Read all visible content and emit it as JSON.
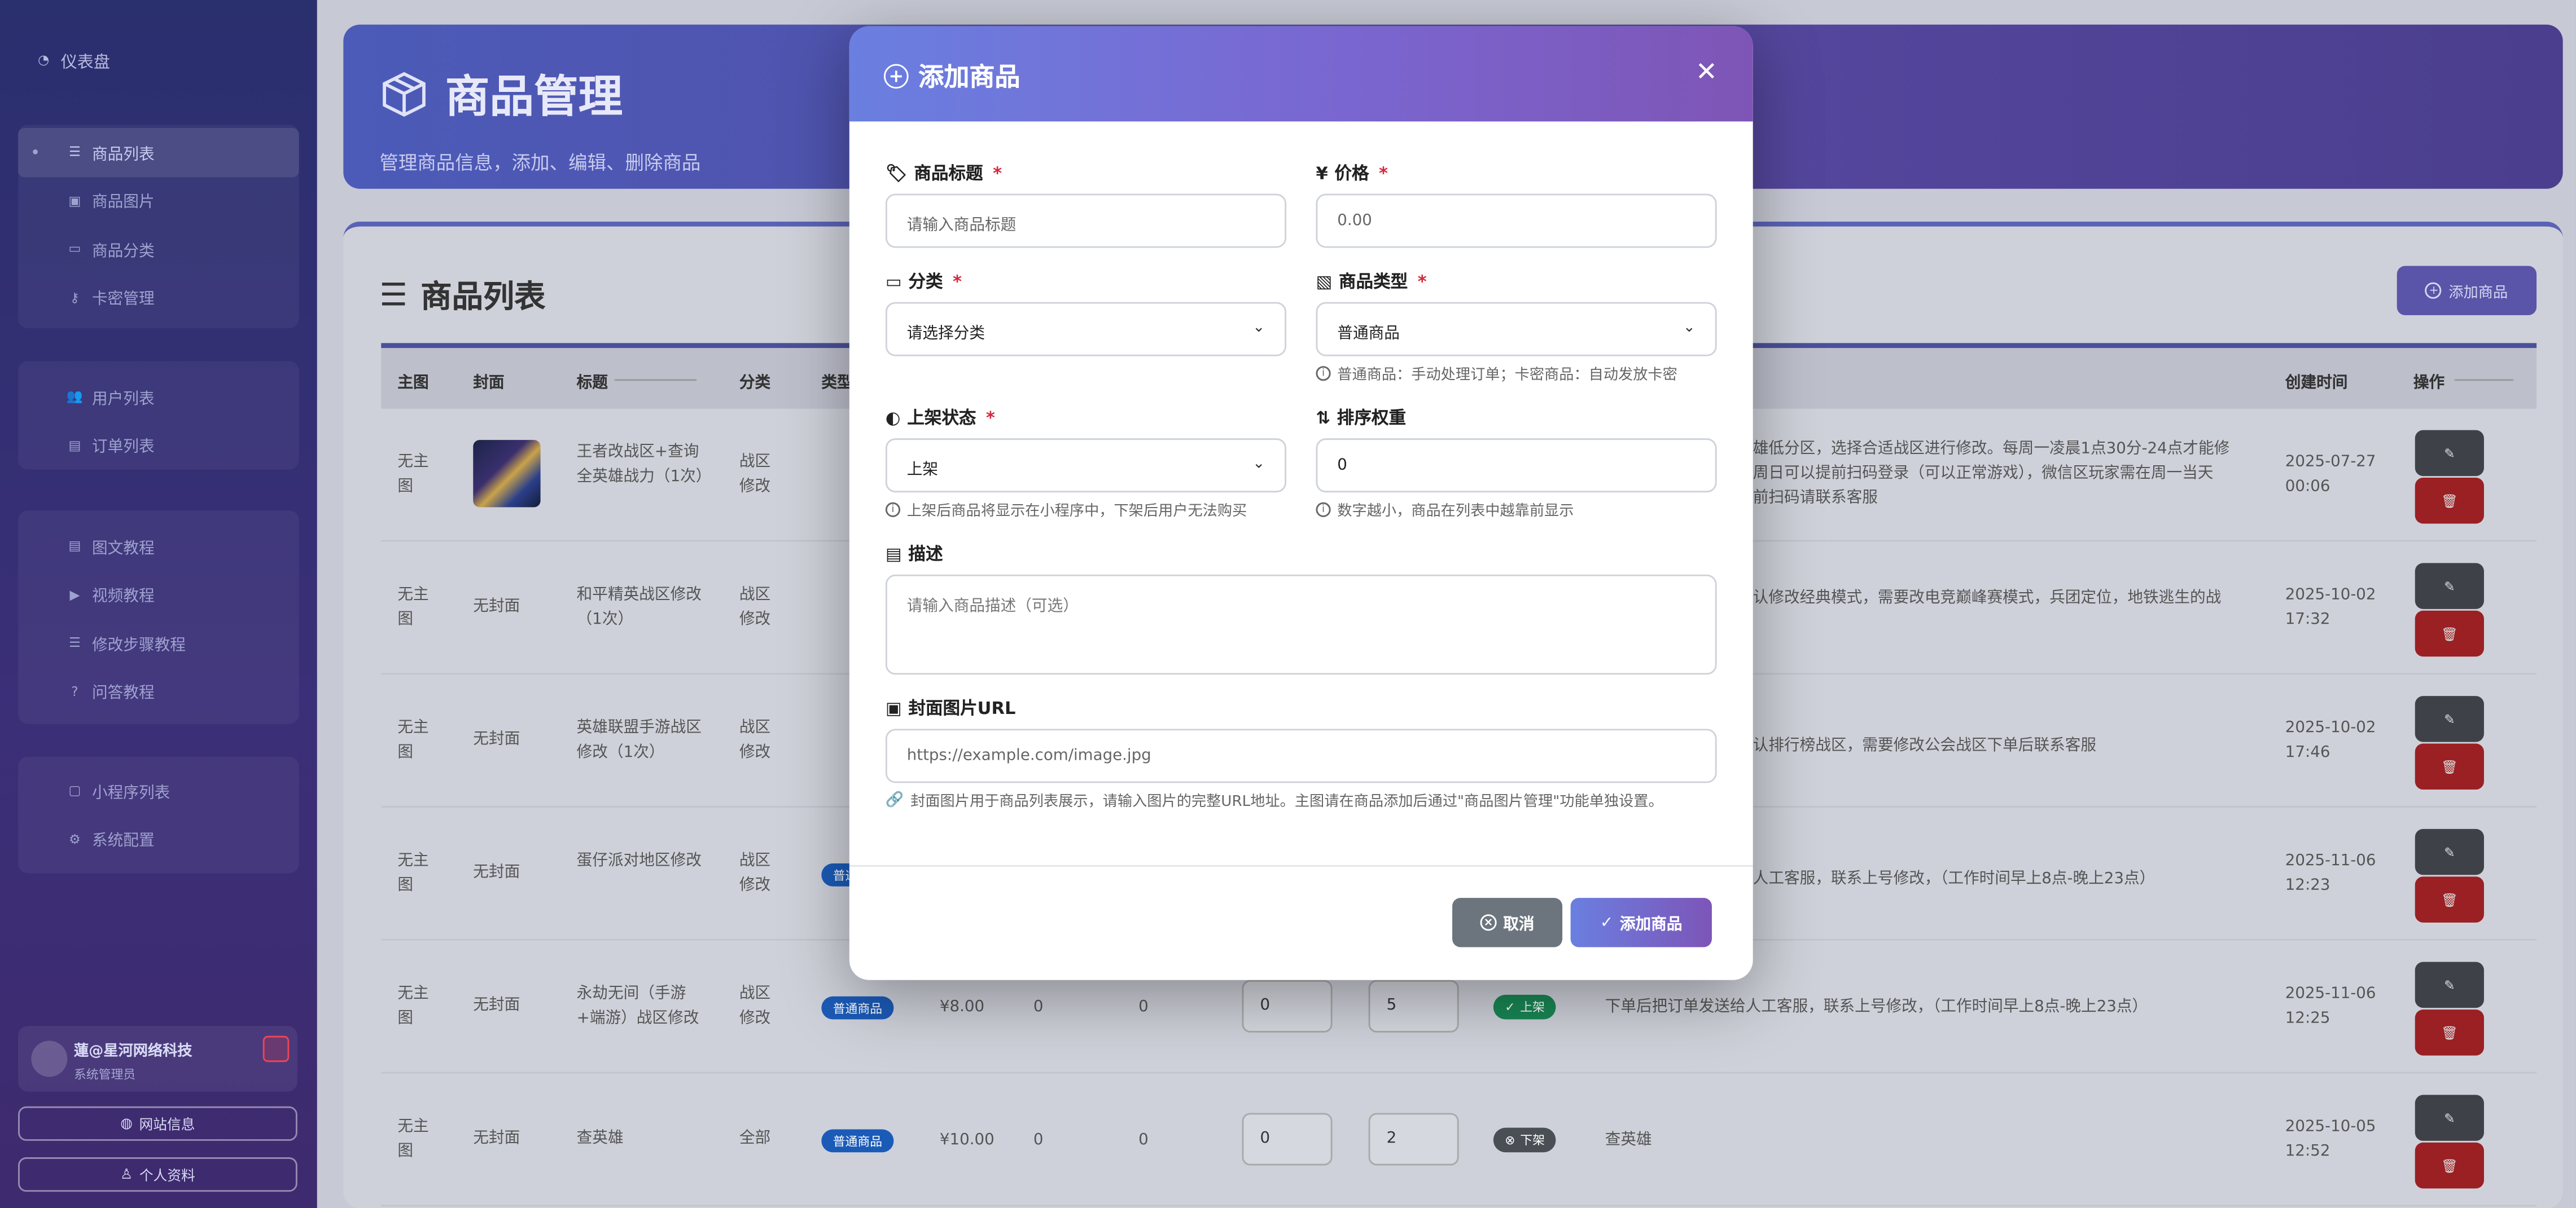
{
  "sidebar": {
    "dashboard": "仪表盘",
    "group1": [
      "商品列表",
      "商品图片",
      "商品分类",
      "卡密管理"
    ],
    "group2": [
      "用户列表",
      "订单列表"
    ],
    "group3": [
      "图文教程",
      "视频教程",
      "修改步骤教程",
      "问答教程"
    ],
    "group4": [
      "小程序列表",
      "系统配置"
    ],
    "user_name": "蓮@星河网络科技",
    "user_role": "系统管理员",
    "site_info": "网站信息",
    "profile": "个人资料"
  },
  "header": {
    "title": "商品管理",
    "subtitle": "管理商品信息，添加、编辑、删除商品"
  },
  "list": {
    "title": "商品列表",
    "add_button": "添加商品",
    "columns": [
      "主图",
      "封面",
      "标题",
      "分类",
      "类型",
      "创建时间",
      "操作"
    ]
  },
  "rows": [
    {
      "main": "无主图",
      "cover": "",
      "title": "王者改战区+查询全英雄战力（1次）",
      "category": "战区修改",
      "desc": "雄低分区，选择合适战区进行修改。每周一凌晨1点30分-24点才能修|周日可以提前扫码登录（可以正常游戏），微信区玩家需在周一当天|前扫码请联系客服",
      "created": "2025-07-27 00:06"
    },
    {
      "main": "无主图",
      "cover": "无封面",
      "title": "和平精英战区修改（1次）",
      "category": "战区修改",
      "desc": "认修改经典模式，需要改电竞巅峰赛模式，兵团定位，地铁逃生的战",
      "created": "2025-10-02 17:32"
    },
    {
      "main": "无主图",
      "cover": "无封面",
      "title": "英雄联盟手游战区修改（1次）",
      "category": "战区修改",
      "desc": "认排行榜战区，需要修改公会战区下单后联系客服",
      "created": "2025-10-02 17:46"
    },
    {
      "main": "无主图",
      "cover": "无封面",
      "title": "蛋仔派对地区修改",
      "category": "战区修改",
      "type": "普通商品",
      "desc": "人工客服，联系上号修改，（工作时间早上8点-晚上23点）",
      "created": "2025-11-06 12:23"
    },
    {
      "main": "无主图",
      "cover": "无封面",
      "title": "永劫无间（手游+端游）战区修改",
      "category": "战区修改",
      "type": "普通商品",
      "price": "¥8.00",
      "stock": "0",
      "sold": "0",
      "sort1": "0",
      "sort2": "5",
      "status": "上架",
      "desc": "下单后把订单发送给人工客服，联系上号修改，（工作时间早上8点-晚上23点）",
      "created": "2025-11-06 12:25"
    },
    {
      "main": "无主图",
      "cover": "无封面",
      "title": "查英雄",
      "category": "全部",
      "type": "普通商品",
      "price": "¥10.00",
      "stock": "0",
      "sold": "0",
      "sort1": "0",
      "sort2": "2",
      "status": "下架",
      "desc": "查英雄",
      "created": "2025-10-05 12:52"
    }
  ],
  "modal": {
    "title": "添加商品",
    "f_title": "商品标题",
    "f_title_ph": "请输入商品标题",
    "f_price": "价格",
    "f_price_ph": "0.00",
    "f_cat": "分类",
    "f_cat_val": "请选择分类",
    "f_type": "商品类型",
    "f_type_val": "普通商品",
    "f_type_hint": "普通商品：手动处理订单；卡密商品：自动发放卡密",
    "f_status": "上架状态",
    "f_status_val": "上架",
    "f_status_hint": "上架后商品将显示在小程序中，下架后用户无法购买",
    "f_sort": "排序权重",
    "f_sort_val": "0",
    "f_sort_hint": "数字越小，商品在列表中越靠前显示",
    "f_desc": "描述",
    "f_desc_ph": "请输入商品描述（可选）",
    "f_cover": "封面图片URL",
    "f_cover_ph": "https://example.com/image.jpg",
    "f_cover_hint": "封面图片用于商品列表展示，请输入图片的完整URL地址。主图请在商品添加后通过\"商品图片管理\"功能单独设置。",
    "cancel": "取消",
    "submit": "添加商品"
  },
  "colors": {
    "accent": "#6a7fe0",
    "accent2": "#7d55b8",
    "danger": "#d7263d",
    "success": "#198754",
    "primary": "#0d6efd"
  }
}
